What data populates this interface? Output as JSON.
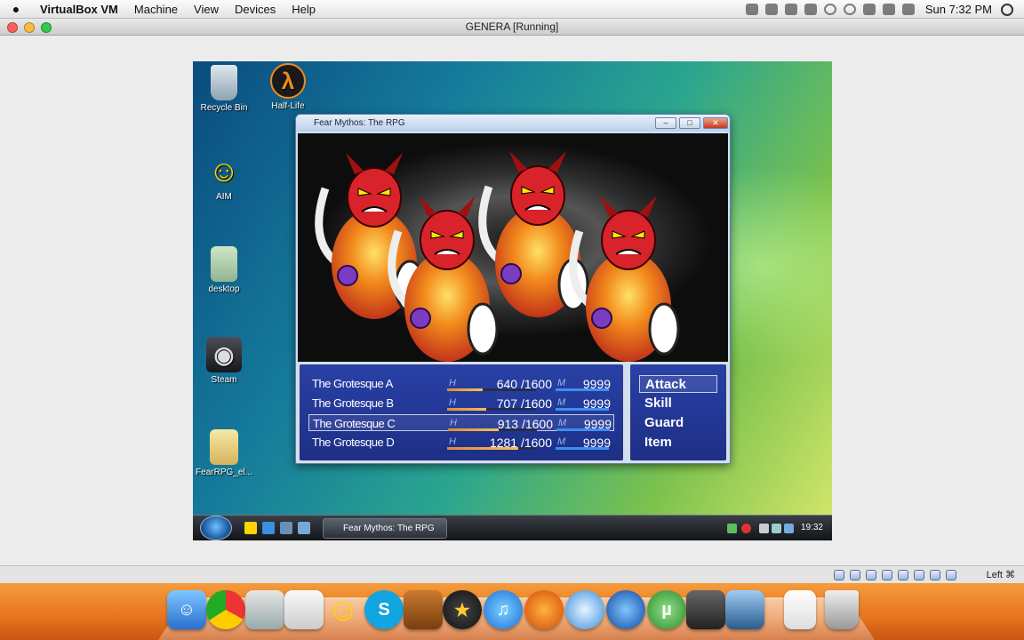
{
  "mac_menubar": {
    "apple": "",
    "menus": [
      "VirtualBox VM",
      "Machine",
      "View",
      "Devices",
      "Help"
    ],
    "clock": "Sun 7:32 PM"
  },
  "vm_window": {
    "title": "GENERA [Running]"
  },
  "guest_desktop": {
    "icons": [
      {
        "label": "Recycle Bin",
        "icon": "recycle-bin-icon"
      },
      {
        "label": "Half-Life",
        "icon": "half-life-icon"
      },
      {
        "label": "AIM",
        "icon": "aim-icon"
      },
      {
        "label": "desktop",
        "icon": "desktop-file-icon"
      },
      {
        "label": "Steam",
        "icon": "steam-icon"
      },
      {
        "label": "FearRPG_el...",
        "icon": "folder-icon"
      }
    ]
  },
  "game_window": {
    "title": "Fear Mythos: The RPG",
    "enemies": [
      {
        "name": "The Grotesque A",
        "hp_label": "H",
        "hp": "640 /1600",
        "hp_ratio": 0.4,
        "mp_label": "M",
        "mp": "9999",
        "selected": false
      },
      {
        "name": "The Grotesque B",
        "hp_label": "H",
        "hp": "707 /1600",
        "hp_ratio": 0.44,
        "mp_label": "M",
        "mp": "9999",
        "selected": false
      },
      {
        "name": "The Grotesque C",
        "hp_label": "H",
        "hp": "913 /1600",
        "hp_ratio": 0.57,
        "mp_label": "M",
        "mp": "9999",
        "selected": true
      },
      {
        "name": "The Grotesque D",
        "hp_label": "H",
        "hp": "1281 /1600",
        "hp_ratio": 0.8,
        "mp_label": "M",
        "mp": "9999",
        "selected": false
      }
    ],
    "commands": [
      "Attack",
      "Skill",
      "Guard",
      "Item"
    ],
    "selected_command": "Attack"
  },
  "guest_taskbar": {
    "task_label": "Fear Mythos: The RPG",
    "clock": "19:32"
  },
  "vm_statusbar": {
    "host_key": "Left ⌘"
  },
  "colors": {
    "battle_panel": "#2438a0",
    "dock_orange": "#e8731f",
    "enemy_red": "#d9232a",
    "flame_orange": "#f28a1c"
  }
}
